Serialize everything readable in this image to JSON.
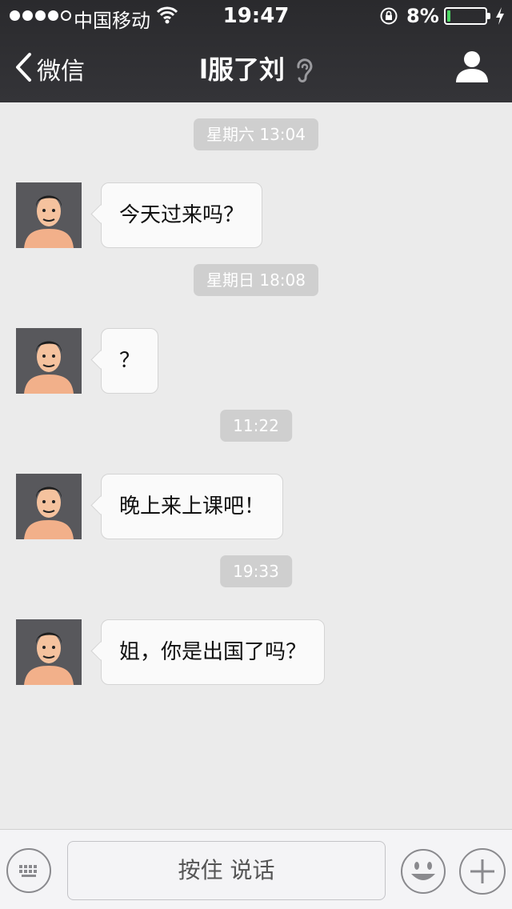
{
  "status_bar": {
    "carrier": "中国移动",
    "time": "19:47",
    "battery_percent": "8%",
    "battery_level": 0.08,
    "icons": [
      "signal-dots-icon",
      "wifi-icon",
      "rotation-lock-icon",
      "battery-icon",
      "charging-bolt-icon"
    ]
  },
  "nav": {
    "back_label": "微信",
    "title": "l服了刘",
    "icons": [
      "back-chevron-icon",
      "ear-icon",
      "profile-icon"
    ]
  },
  "chat": {
    "messages": [
      {
        "timestamp": "星期六 13:04",
        "text": "今天过来吗？"
      },
      {
        "timestamp": "星期日 18:08",
        "text": "？"
      },
      {
        "timestamp": "11:22",
        "text": "晚上来上课吧！"
      },
      {
        "timestamp": "19:33",
        "text": "姐，你是出国了吗？"
      }
    ]
  },
  "input_bar": {
    "hold_to_talk_label": "按住 说话",
    "icons": [
      "keyboard-icon",
      "emoji-icon",
      "plus-icon"
    ]
  },
  "colors": {
    "header_bg": "#2e2e32",
    "chat_bg": "#ebebeb",
    "timestamp_bg": "#cfcfcf",
    "bubble_bg": "#fafafa",
    "battery_green": "#4cd964"
  }
}
